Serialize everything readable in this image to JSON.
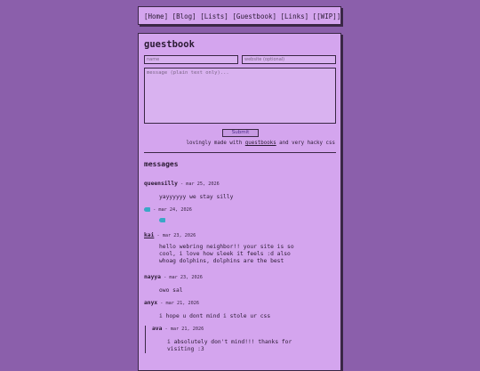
{
  "nav": {
    "items": [
      "[Home]",
      "[Blog]",
      "[Lists]",
      "[Guestbook]",
      "[Links]",
      "[[WIP]]"
    ]
  },
  "guestbook": {
    "title": "guestbook",
    "name_placeholder": "name",
    "website_placeholder": "website (optional)",
    "message_placeholder": "message (plain text only)...",
    "submit_label": "Submit",
    "credit_prefix": "lovingly made with ",
    "credit_link": "guestbooks",
    "credit_suffix": " and very hacky css",
    "messages_heading": "messages"
  },
  "entries": [
    {
      "author": "queensilly",
      "date": "mar 25, 2026",
      "body": "yayyyyyy we stay silly"
    },
    {
      "author": "",
      "date": "mar 24, 2026",
      "body": "",
      "icon": "fish-emoji-icon"
    },
    {
      "author": "kai",
      "date": "mar 23, 2026",
      "body": "hello webring neighbor!! your site is so\ncool, i love how sleek it feels :d also\nwhoag dolphins, dolphins are the best"
    },
    {
      "author": "nayya",
      "date": "mar 23, 2026",
      "body": "owo sal"
    },
    {
      "author": "anyx",
      "date": "mar 21, 2026",
      "body": "i hope u dont mind i stole ur css"
    },
    {
      "author": "ava",
      "date": "mar 21, 2026",
      "body": "i absolutely don't mind!!! thanks for\nvisiting :3"
    }
  ],
  "colors": {
    "background": "#8b5fab",
    "panel": "#d4a5ee",
    "border": "#3a2745",
    "link": "#4a2b8a"
  }
}
